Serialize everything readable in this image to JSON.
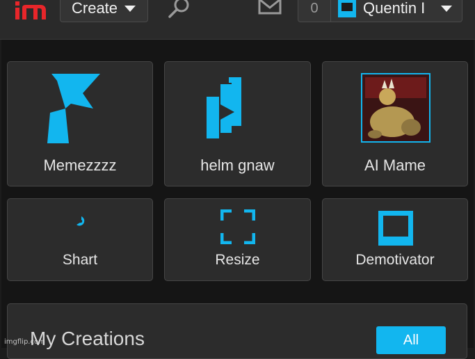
{
  "header": {
    "create_label": "Create",
    "notification_count": "0",
    "username": "Quentin I"
  },
  "tiles": [
    {
      "label": "Memezzzz",
      "icon": "meme-generator-icon"
    },
    {
      "label": "helm gnaw",
      "icon": "video-stack-icon"
    },
    {
      "label": "AI Mame",
      "icon": "ai-image-thumbnail"
    },
    {
      "label": "Shart",
      "icon": "spinner-icon"
    },
    {
      "label": "Resize",
      "icon": "resize-icon"
    },
    {
      "label": "Demotivator",
      "icon": "demotivator-icon"
    }
  ],
  "section": {
    "title": "My Creations",
    "all_label": "All"
  },
  "watermark": "imgflip.com",
  "colors": {
    "accent": "#12b6ef",
    "logo_red": "#e8262a",
    "tile_bg": "#2c2c2c",
    "page_bg": "#151515"
  }
}
